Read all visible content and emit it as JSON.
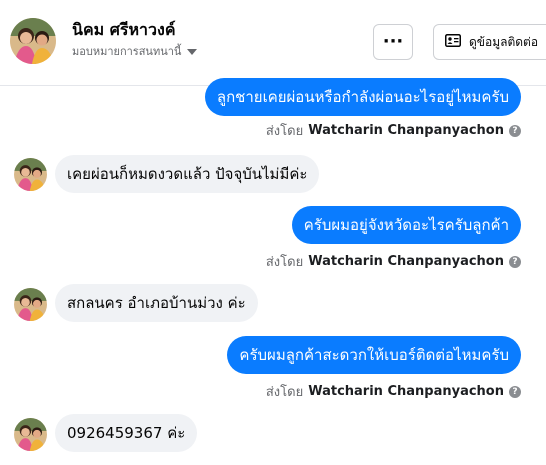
{
  "header": {
    "name": "นิคม ศรีหาวงค์",
    "assign_label": "มอบหมายการสนทนานี้",
    "more_label": "···",
    "contact_label": "ดูข้อมูลติดต่อ"
  },
  "messages": [
    {
      "direction": "out",
      "text": "ลูกชายเคยผ่อนหรือกำลังผ่อนอะไรอยู่ไหมครับ",
      "sent_by_prefix": "ส่งโดย",
      "sent_by_name": "Watcharin Chanpanyachon"
    },
    {
      "direction": "in",
      "text": "เคยผ่อนก็หมดงวดแล้ว ปัจจุบันไม่มีค่ะ"
    },
    {
      "direction": "out",
      "text": "ครับผมอยู่จังหวัดอะไรครับลูกค้า",
      "sent_by_prefix": "ส่งโดย",
      "sent_by_name": "Watcharin Chanpanyachon"
    },
    {
      "direction": "in",
      "text": "สกลนคร อำเภอบ้านม่วง ค่ะ"
    },
    {
      "direction": "out",
      "text": "ครับผมลูกค้าสะดวกให้เบอร์ติดต่อไหมครับ",
      "sent_by_prefix": "ส่งโดย",
      "sent_by_name": "Watcharin Chanpanyachon"
    },
    {
      "direction": "in",
      "text": "0926459367 ค่ะ"
    }
  ],
  "colors": {
    "outgoing_bubble": "#0a7cff",
    "incoming_bubble": "#f0f2f5",
    "meta_text": "#65676b"
  },
  "icons": {
    "more": "more-dots-icon",
    "contact": "contact-card-icon",
    "help": "help-circle-icon",
    "caret": "caret-down-icon"
  }
}
